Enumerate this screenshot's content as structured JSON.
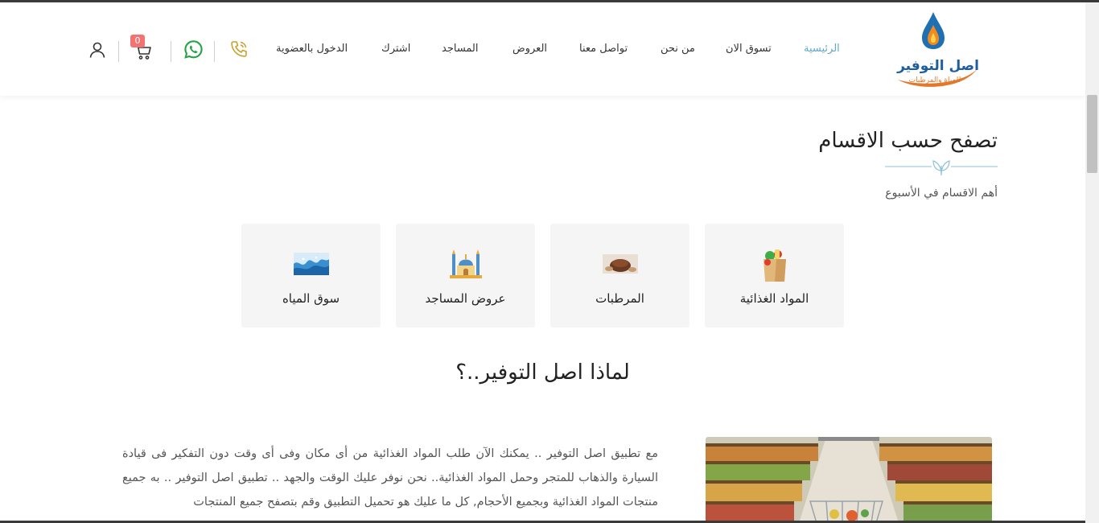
{
  "brand": {
    "name": "اصل التوفير",
    "tagline": "للمياة والمرطبات"
  },
  "nav": [
    {
      "label": "الرئيسية",
      "active": true
    },
    {
      "label": "تسوق الان",
      "active": false
    },
    {
      "label": "من نحن",
      "active": false
    },
    {
      "label": "تواصل معنا",
      "active": false
    },
    {
      "label": "العروض",
      "active": false
    },
    {
      "label": "المساجد",
      "active": false
    },
    {
      "label": "اشترك",
      "active": false
    },
    {
      "label": "الدخول بالعضوية",
      "active": false
    }
  ],
  "header_icons": {
    "phone": "phone-icon",
    "whatsapp": "whatsapp-icon",
    "cart": "cart-icon",
    "user": "user-icon",
    "cart_count": "0"
  },
  "categories_section": {
    "title": "تصفح حسب الاقسام",
    "subtitle": "أهم الاقسام في الأسبوع",
    "items": [
      {
        "label": "المواد الغذائية",
        "icon": "grocery-bag-icon"
      },
      {
        "label": "المرطبات",
        "icon": "refreshments-icon"
      },
      {
        "label": "عروض المساجد",
        "icon": "mosque-icon"
      },
      {
        "label": "سوق المياه",
        "icon": "water-icon"
      }
    ]
  },
  "why": {
    "title": "لماذا اصل التوفير..؟",
    "text": "مع تطبيق اصل التوفير .. يمكنك الآن طلب المواد الغذائية من أى مكان وفى أى وقت دون التفكير فى قيادة السيارة والذهاب للمتجر وحمل المواد الغذائية.. نحن نوفر عليك الوقت والجهد .. تطبيق اصل التوفير .. به جميع منتجات المواد الغذائية وبجميع الأحجام, كل ما عليك هو تحميل التطبيق وقم بتصفح جميع المنتجات"
  },
  "colors": {
    "accent": "#62a9c9",
    "badge": "#f27372",
    "whatsapp": "#25a244",
    "phone": "#c9a12a",
    "card_bg": "#f5f5f5"
  }
}
